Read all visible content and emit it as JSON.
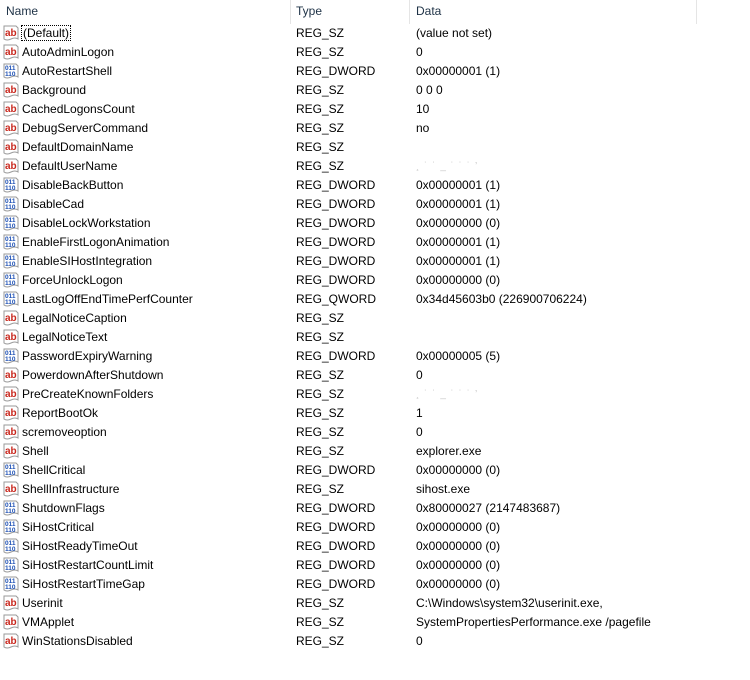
{
  "columns": {
    "name": "Name",
    "type": "Type",
    "data": "Data"
  },
  "rows": [
    {
      "name": "(Default)",
      "type": "REG_SZ",
      "data": "(value not set)",
      "icon": "string-value-icon",
      "focused": true
    },
    {
      "name": "AutoAdminLogon",
      "type": "REG_SZ",
      "data": "0",
      "icon": "string-value-icon"
    },
    {
      "name": "AutoRestartShell",
      "type": "REG_DWORD",
      "data": "0x00000001 (1)",
      "icon": "binary-value-icon"
    },
    {
      "name": "Background",
      "type": "REG_SZ",
      "data": "0 0 0",
      "icon": "string-value-icon"
    },
    {
      "name": "CachedLogonsCount",
      "type": "REG_SZ",
      "data": "10",
      "icon": "string-value-icon"
    },
    {
      "name": "DebugServerCommand",
      "type": "REG_SZ",
      "data": "no",
      "icon": "string-value-icon"
    },
    {
      "name": "DefaultDomainName",
      "type": "REG_SZ",
      "data": "",
      "icon": "string-value-icon"
    },
    {
      "name": "DefaultUserName",
      "type": "REG_SZ",
      "data": "[redacted]",
      "icon": "string-value-icon",
      "redacted": true
    },
    {
      "name": "DisableBackButton",
      "type": "REG_DWORD",
      "data": "0x00000001 (1)",
      "icon": "binary-value-icon"
    },
    {
      "name": "DisableCad",
      "type": "REG_DWORD",
      "data": "0x00000001 (1)",
      "icon": "binary-value-icon"
    },
    {
      "name": "DisableLockWorkstation",
      "type": "REG_DWORD",
      "data": "0x00000000 (0)",
      "icon": "binary-value-icon"
    },
    {
      "name": "EnableFirstLogonAnimation",
      "type": "REG_DWORD",
      "data": "0x00000001 (1)",
      "icon": "binary-value-icon"
    },
    {
      "name": "EnableSIHostIntegration",
      "type": "REG_DWORD",
      "data": "0x00000001 (1)",
      "icon": "binary-value-icon"
    },
    {
      "name": "ForceUnlockLogon",
      "type": "REG_DWORD",
      "data": "0x00000000 (0)",
      "icon": "binary-value-icon"
    },
    {
      "name": "LastLogOffEndTimePerfCounter",
      "type": "REG_QWORD",
      "data": "0x34d45603b0 (226900706224)",
      "icon": "binary-value-icon"
    },
    {
      "name": "LegalNoticeCaption",
      "type": "REG_SZ",
      "data": "",
      "icon": "string-value-icon"
    },
    {
      "name": "LegalNoticeText",
      "type": "REG_SZ",
      "data": "",
      "icon": "string-value-icon"
    },
    {
      "name": "PasswordExpiryWarning",
      "type": "REG_DWORD",
      "data": "0x00000005 (5)",
      "icon": "binary-value-icon"
    },
    {
      "name": "PowerdownAfterShutdown",
      "type": "REG_SZ",
      "data": "0",
      "icon": "string-value-icon"
    },
    {
      "name": "PreCreateKnownFolders",
      "type": "REG_SZ",
      "data": "[redacted]",
      "icon": "string-value-icon",
      "redacted": true
    },
    {
      "name": "ReportBootOk",
      "type": "REG_SZ",
      "data": "1",
      "icon": "string-value-icon"
    },
    {
      "name": "scremoveoption",
      "type": "REG_SZ",
      "data": "0",
      "icon": "string-value-icon"
    },
    {
      "name": "Shell",
      "type": "REG_SZ",
      "data": "explorer.exe",
      "icon": "string-value-icon"
    },
    {
      "name": "ShellCritical",
      "type": "REG_DWORD",
      "data": "0x00000000 (0)",
      "icon": "binary-value-icon"
    },
    {
      "name": "ShellInfrastructure",
      "type": "REG_SZ",
      "data": "sihost.exe",
      "icon": "string-value-icon"
    },
    {
      "name": "ShutdownFlags",
      "type": "REG_DWORD",
      "data": "0x80000027 (2147483687)",
      "icon": "binary-value-icon"
    },
    {
      "name": "SiHostCritical",
      "type": "REG_DWORD",
      "data": "0x00000000 (0)",
      "icon": "binary-value-icon"
    },
    {
      "name": "SiHostReadyTimeOut",
      "type": "REG_DWORD",
      "data": "0x00000000 (0)",
      "icon": "binary-value-icon"
    },
    {
      "name": "SiHostRestartCountLimit",
      "type": "REG_DWORD",
      "data": "0x00000000 (0)",
      "icon": "binary-value-icon"
    },
    {
      "name": "SiHostRestartTimeGap",
      "type": "REG_DWORD",
      "data": "0x00000000 (0)",
      "icon": "binary-value-icon"
    },
    {
      "name": "Userinit",
      "type": "REG_SZ",
      "data": "C:\\Windows\\system32\\userinit.exe,",
      "icon": "string-value-icon"
    },
    {
      "name": "VMApplet",
      "type": "REG_SZ",
      "data": "SystemPropertiesPerformance.exe /pagefile",
      "icon": "string-value-icon"
    },
    {
      "name": "WinStationsDisabled",
      "type": "REG_SZ",
      "data": "0",
      "icon": "string-value-icon"
    }
  ],
  "colors": {
    "string_icon": "#c8281e",
    "binary_icon": "#1c4fb4",
    "header_text": "#1e3246"
  }
}
